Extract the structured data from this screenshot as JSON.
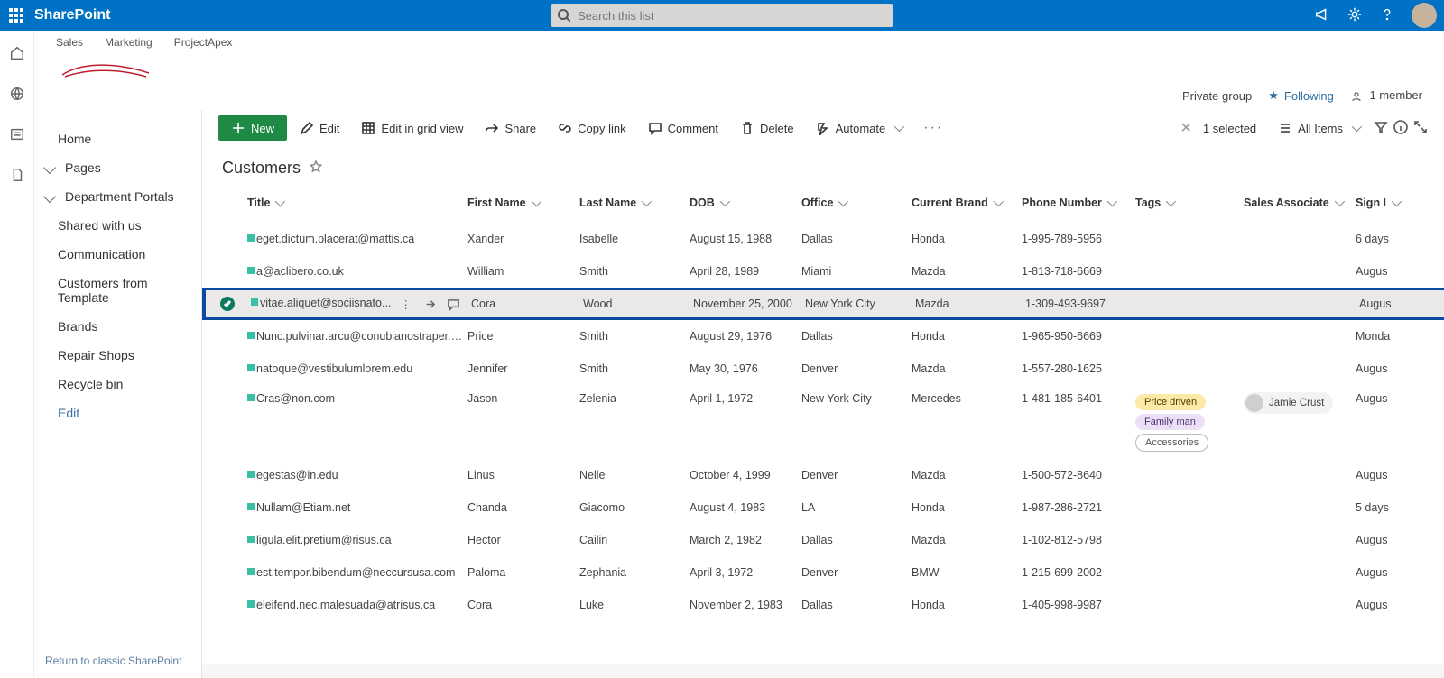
{
  "suite": {
    "app_name": "SharePoint",
    "search_placeholder": "Search this list"
  },
  "hub_nav": [
    "Sales",
    "Marketing",
    "ProjectApex"
  ],
  "site_meta": {
    "privacy": "Private group",
    "following": "Following",
    "members": "1 member"
  },
  "left_nav": {
    "items": [
      {
        "label": "Home"
      },
      {
        "label": "Pages",
        "chevron": true
      },
      {
        "label": "Department Portals",
        "chevron": true
      },
      {
        "label": "Shared with us"
      },
      {
        "label": "Communication"
      },
      {
        "label": "Customers from Template"
      },
      {
        "label": "Brands"
      },
      {
        "label": "Repair Shops"
      },
      {
        "label": "Recycle bin"
      },
      {
        "label": "Edit",
        "edit": true
      }
    ],
    "return_link": "Return to classic SharePoint"
  },
  "cmdbar": {
    "new": "New",
    "edit": "Edit",
    "edit_grid": "Edit in grid view",
    "share": "Share",
    "copy_link": "Copy link",
    "comment": "Comment",
    "delete": "Delete",
    "automate": "Automate",
    "selected": "1 selected",
    "view_name": "All Items"
  },
  "list": {
    "title": "Customers",
    "columns": [
      "Title",
      "First Name",
      "Last Name",
      "DOB",
      "Office",
      "Current Brand",
      "Phone Number",
      "Tags",
      "Sales Associate",
      "Sign I"
    ],
    "rows": [
      {
        "title": "eget.dictum.placerat@mattis.ca",
        "first": "Xander",
        "last": "Isabelle",
        "dob": "August 15, 1988",
        "office": "Dallas",
        "brand": "Honda",
        "phone": "1-995-789-5956",
        "tags": [],
        "assoc": "",
        "sign": "6 days"
      },
      {
        "title": "a@aclibero.co.uk",
        "first": "William",
        "last": "Smith",
        "dob": "April 28, 1989",
        "office": "Miami",
        "brand": "Mazda",
        "phone": "1-813-718-6669",
        "tags": [],
        "assoc": "",
        "sign": "Augus"
      },
      {
        "title": "vitae.aliquet@sociisnato...",
        "first": "Cora",
        "last": "Wood",
        "dob": "November 25, 2000",
        "office": "New York City",
        "brand": "Mazda",
        "phone": "1-309-493-9697",
        "tags": [],
        "assoc": "",
        "sign": "Augus",
        "selected": true
      },
      {
        "title": "Nunc.pulvinar.arcu@conubianostraper.edu",
        "first": "Price",
        "last": "Smith",
        "dob": "August 29, 1976",
        "office": "Dallas",
        "brand": "Honda",
        "phone": "1-965-950-6669",
        "tags": [],
        "assoc": "",
        "sign": "Monda"
      },
      {
        "title": "natoque@vestibulumlorem.edu",
        "first": "Jennifer",
        "last": "Smith",
        "dob": "May 30, 1976",
        "office": "Denver",
        "brand": "Mazda",
        "phone": "1-557-280-1625",
        "tags": [],
        "assoc": "",
        "sign": "Augus"
      },
      {
        "title": "Cras@non.com",
        "first": "Jason",
        "last": "Zelenia",
        "dob": "April 1, 1972",
        "office": "New York City",
        "brand": "Mercedes",
        "phone": "1-481-185-6401",
        "tags": [
          "Price driven",
          "Family man",
          "Accessories"
        ],
        "assoc": "Jamie Crust",
        "sign": "Augus"
      },
      {
        "title": "egestas@in.edu",
        "first": "Linus",
        "last": "Nelle",
        "dob": "October 4, 1999",
        "office": "Denver",
        "brand": "Mazda",
        "phone": "1-500-572-8640",
        "tags": [],
        "assoc": "",
        "sign": "Augus"
      },
      {
        "title": "Nullam@Etiam.net",
        "first": "Chanda",
        "last": "Giacomo",
        "dob": "August 4, 1983",
        "office": "LA",
        "brand": "Honda",
        "phone": "1-987-286-2721",
        "tags": [],
        "assoc": "",
        "sign": "5 days"
      },
      {
        "title": "ligula.elit.pretium@risus.ca",
        "first": "Hector",
        "last": "Cailin",
        "dob": "March 2, 1982",
        "office": "Dallas",
        "brand": "Mazda",
        "phone": "1-102-812-5798",
        "tags": [],
        "assoc": "",
        "sign": "Augus"
      },
      {
        "title": "est.tempor.bibendum@neccursusa.com",
        "first": "Paloma",
        "last": "Zephania",
        "dob": "April 3, 1972",
        "office": "Denver",
        "brand": "BMW",
        "phone": "1-215-699-2002",
        "tags": [],
        "assoc": "",
        "sign": "Augus"
      },
      {
        "title": "eleifend.nec.malesuada@atrisus.ca",
        "first": "Cora",
        "last": "Luke",
        "dob": "November 2, 1983",
        "office": "Dallas",
        "brand": "Honda",
        "phone": "1-405-998-9987",
        "tags": [],
        "assoc": "",
        "sign": "Augus"
      }
    ]
  }
}
